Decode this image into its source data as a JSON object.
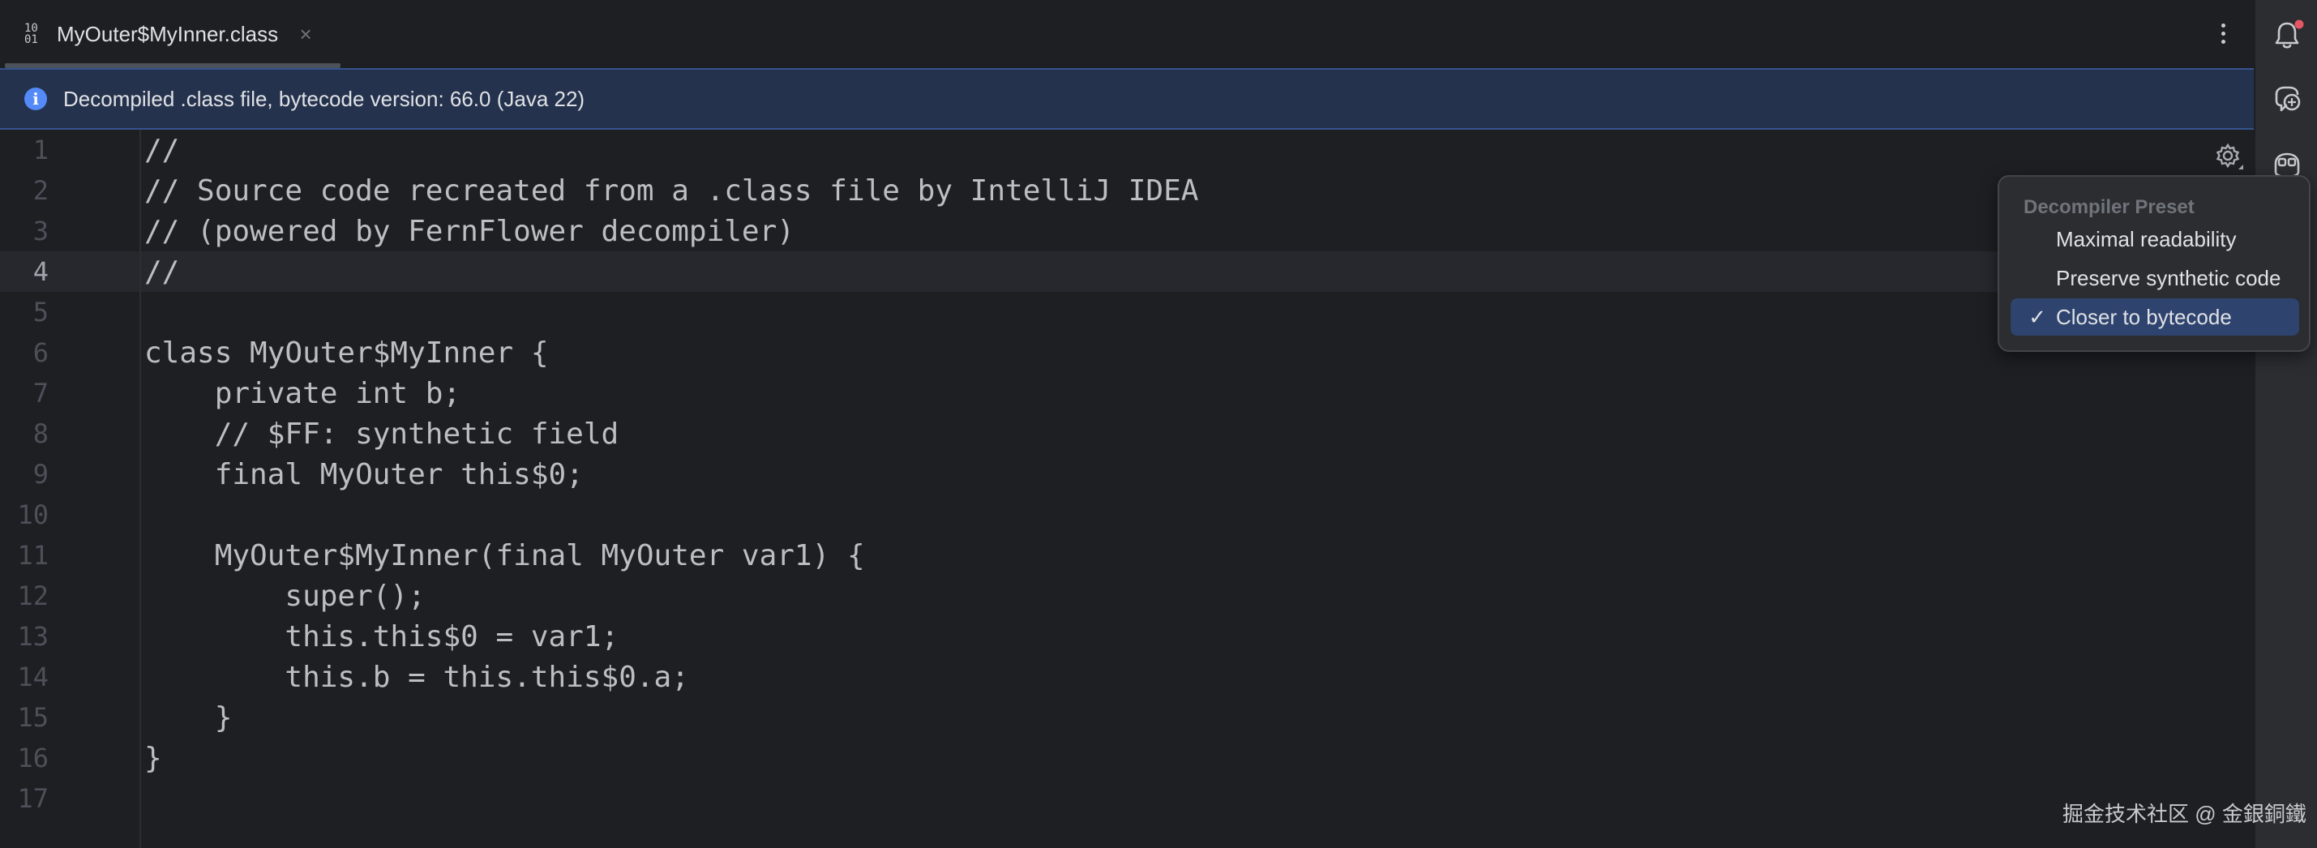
{
  "tab": {
    "icon_top": "10",
    "icon_bottom": "01",
    "title": "MyOuter$MyInner.class",
    "close": "×"
  },
  "banner": {
    "icon": "i",
    "text": "Decompiled .class file, bytecode version: 66.0 (Java 22)"
  },
  "editor": {
    "current_line": 4,
    "lines": [
      "//",
      "// Source code recreated from a .class file by IntelliJ IDEA",
      "// (powered by FernFlower decompiler)",
      "//",
      "",
      "class MyOuter$MyInner {",
      "    private int b;",
      "    // $FF: synthetic field",
      "    final MyOuter this$0;",
      "",
      "    MyOuter$MyInner(final MyOuter var1) {",
      "        super();",
      "        this.this$0 = var1;",
      "        this.b = this.this$0.a;",
      "    }",
      "}",
      ""
    ],
    "line_numbers": [
      "1",
      "2",
      "3",
      "4",
      "5",
      "6",
      "7",
      "8",
      "9",
      "10",
      "11",
      "12",
      "13",
      "14",
      "15",
      "16",
      "17"
    ]
  },
  "popup": {
    "header": "Decompiler Preset",
    "items": [
      {
        "label": "Maximal readability",
        "check": ""
      },
      {
        "label": "Preserve synthetic code",
        "check": ""
      },
      {
        "label": "Closer to bytecode",
        "check": "✓"
      }
    ]
  },
  "icons": {
    "tab": "binary-file-icon",
    "close": "close-icon",
    "menu": "more-vertical-icon",
    "info": "info-icon",
    "settings": "gear-icon",
    "notifications": "bell-icon",
    "ai_assistant": "ai-chat-icon",
    "copilot": "copilot-icon"
  },
  "colors": {
    "background": "#1e1f22",
    "banner": "#25324d",
    "accent": "#548af7",
    "selection": "#2e436e",
    "notification_dot": "#e55765"
  },
  "watermark": "掘金技术社区 @ 金銀銅鐵"
}
